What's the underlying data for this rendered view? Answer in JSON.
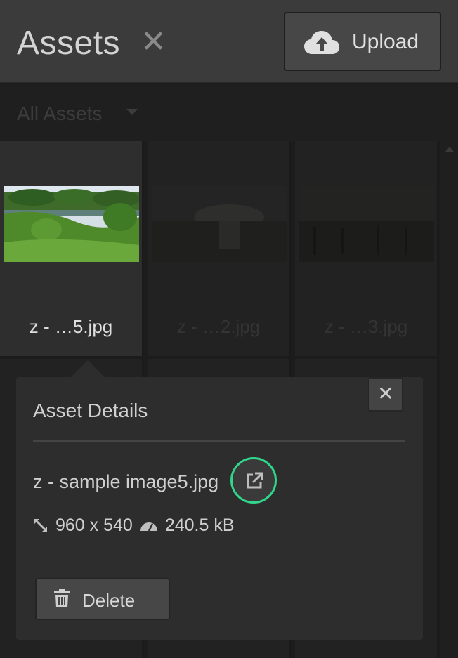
{
  "header": {
    "title": "Assets",
    "close_glyph": "✕",
    "upload_label": "Upload",
    "upload_icon": "cloud-upload-icon"
  },
  "filter": {
    "label": "All Assets",
    "caret_icon": "caret-down-icon"
  },
  "grid": {
    "items": [
      {
        "name": "z - …5.jpg",
        "selected": true
      },
      {
        "name": "z - …2.jpg",
        "selected": false
      },
      {
        "name": "z - …3.jpg",
        "selected": false
      }
    ]
  },
  "details": {
    "heading": "Asset Details",
    "close_glyph": "✕",
    "filename": "z - sample image5.jpg",
    "external_link_icon": "external-link-icon",
    "dimensions": "960 x 540",
    "size": "240.5 kB",
    "delete_label": "Delete",
    "highlight_color": "#2fd68c"
  }
}
